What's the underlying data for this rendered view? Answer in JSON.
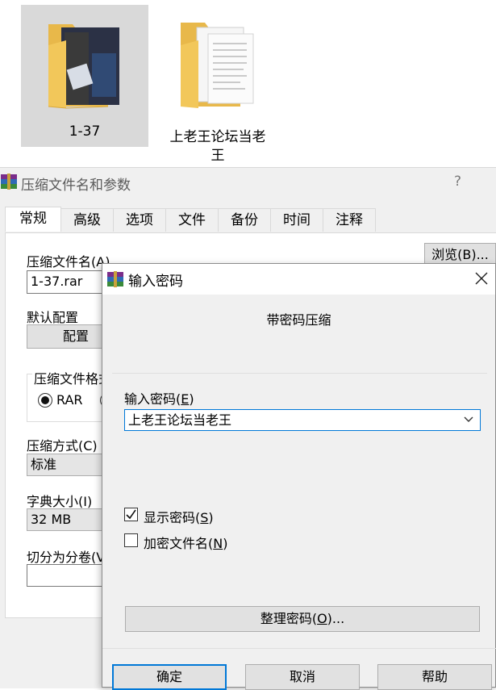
{
  "desktop": {
    "folders": [
      {
        "name": "1-37"
      },
      {
        "name_line1": "上老王论坛当老",
        "name_line2": "王"
      }
    ]
  },
  "main_dialog": {
    "title": "压缩文件名和参数",
    "help": "?",
    "tabs": [
      "常规",
      "高级",
      "选项",
      "文件",
      "备份",
      "时间",
      "注释"
    ],
    "archive_name_label": "压缩文件名(A)",
    "browse_button": "浏览(B)...",
    "archive_name_value": "1-37.rar",
    "default_profile_label": "默认配置",
    "profiles_button": "配置",
    "format_group_label": "压缩文件格式",
    "format_rar": "RAR",
    "method_label": "压缩方式(C)",
    "method_value": "标准",
    "dict_label": "字典大小(I)",
    "dict_value": "32 MB",
    "split_label": "切分为分卷(V"
  },
  "password_dialog": {
    "title": "输入密码",
    "subtitle": "带密码压缩",
    "password_label": "输入密码",
    "password_accel": "E",
    "password_value": "上老王论坛当老王",
    "show_password_label": "显示密码",
    "show_password_accel": "S",
    "show_password_checked": true,
    "encrypt_names_label": "加密文件名",
    "encrypt_names_accel": "N",
    "encrypt_names_checked": false,
    "organize_button": "整理密码",
    "organize_accel": "O",
    "ok_button": "确定",
    "cancel_button": "取消",
    "help_button": "帮助"
  }
}
